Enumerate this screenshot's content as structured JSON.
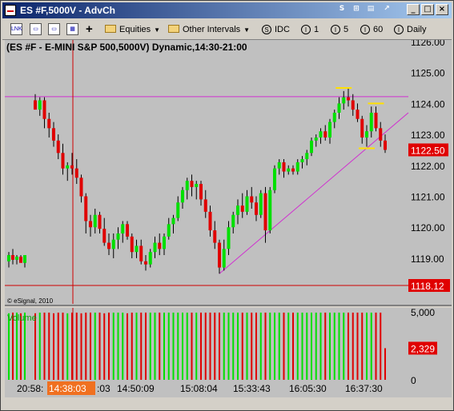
{
  "window": {
    "title": "ES #F,5000V - AdvCh"
  },
  "toolbar": {
    "equities": "Equities",
    "other_intervals": "Other Intervals",
    "idc": "IDC",
    "i1": "1",
    "i5": "5",
    "i60": "60",
    "daily": "Daily"
  },
  "chart_data": {
    "type": "candlestick",
    "title": "(ES #F - E-MINI S&P 500,5000V) Dynamic,14:30-21:00",
    "copyright": "© eSignal, 2010",
    "price_axis": {
      "labels": [
        "1126.00",
        "1125.00",
        "1124.00",
        "1123.00",
        "1122.00",
        "1121.00",
        "1120.00",
        "1119.00"
      ],
      "ylim": [
        1117.5,
        1126.05
      ]
    },
    "last_price": "1122.50",
    "line_price": "1118.12",
    "upper_line_price": 1124.22,
    "volume_label": "Volume",
    "volume_axis": {
      "labels": [
        "5,000",
        "0"
      ],
      "ylim": [
        0,
        5300
      ]
    },
    "last_volume": "2,329",
    "time_labels": [
      "20:58:",
      "14:38:03",
      ":03",
      "14:50:09",
      "15:08:04",
      "15:33:43",
      "16:05:30",
      "16:37:30"
    ],
    "cursor_time": "14:38:03",
    "candles": [
      [
        1118.9,
        1119.2,
        1118.7,
        1119.1
      ],
      [
        1119.1,
        1119.3,
        1118.8,
        1118.95
      ],
      [
        1118.95,
        1119.1,
        1118.8,
        1119.05
      ],
      [
        1119.05,
        1119.1,
        1118.9,
        1118.85
      ],
      [
        1118.85,
        1118.9,
        1118.7,
        1119.1
      ],
      [
        1124.1,
        1124.3,
        1123.9,
        1123.8
      ],
      [
        1123.8,
        1124.2,
        1123.6,
        1124.1
      ],
      [
        1124.1,
        1124.2,
        1123.2,
        1123.5
      ],
      [
        1123.5,
        1123.7,
        1122.9,
        1123.2
      ],
      [
        1123.2,
        1123.4,
        1122.6,
        1122.8
      ],
      [
        1122.8,
        1123.0,
        1122.2,
        1122.4
      ],
      [
        1122.4,
        1122.7,
        1121.7,
        1121.9
      ],
      [
        1121.9,
        1122.1,
        1121.5,
        1122.0
      ],
      [
        1122.0,
        1122.4,
        1121.7,
        1121.9
      ],
      [
        1121.9,
        1122.2,
        1121.4,
        1121.6
      ],
      [
        1121.6,
        1121.7,
        1120.8,
        1121.0
      ],
      [
        1121.0,
        1121.1,
        1119.8,
        1120.2
      ],
      [
        1120.2,
        1120.4,
        1119.7,
        1120.0
      ],
      [
        1120.0,
        1120.6,
        1119.8,
        1120.4
      ],
      [
        1120.4,
        1120.5,
        1119.8,
        1119.95
      ],
      [
        1119.95,
        1120.3,
        1119.4,
        1119.5
      ],
      [
        1119.5,
        1119.8,
        1119.1,
        1119.3
      ],
      [
        1119.3,
        1119.8,
        1119.0,
        1119.6
      ],
      [
        1119.6,
        1120.0,
        1119.3,
        1119.8
      ],
      [
        1119.8,
        1120.2,
        1119.5,
        1120.1
      ],
      [
        1120.1,
        1120.2,
        1119.6,
        1119.7
      ],
      [
        1119.7,
        1119.8,
        1119.0,
        1119.2
      ],
      [
        1119.2,
        1119.6,
        1119.0,
        1119.4
      ],
      [
        1119.4,
        1119.6,
        1118.8,
        1118.9
      ],
      [
        1118.9,
        1119.1,
        1118.6,
        1118.8
      ],
      [
        1118.8,
        1119.3,
        1118.7,
        1119.2
      ],
      [
        1119.2,
        1119.7,
        1119.0,
        1119.5
      ],
      [
        1119.5,
        1119.8,
        1119.1,
        1119.3
      ],
      [
        1119.3,
        1119.8,
        1119.1,
        1119.7
      ],
      [
        1119.7,
        1120.3,
        1119.6,
        1120.1
      ],
      [
        1120.1,
        1120.4,
        1119.8,
        1120.3
      ],
      [
        1120.3,
        1121.0,
        1120.2,
        1120.8
      ],
      [
        1120.8,
        1121.3,
        1120.6,
        1121.2
      ],
      [
        1121.2,
        1121.6,
        1120.9,
        1121.5
      ],
      [
        1121.5,
        1121.7,
        1121.0,
        1121.3
      ],
      [
        1121.3,
        1121.5,
        1120.9,
        1121.4
      ],
      [
        1121.4,
        1121.5,
        1120.7,
        1120.9
      ],
      [
        1120.9,
        1121.2,
        1120.3,
        1120.5
      ],
      [
        1120.5,
        1120.7,
        1119.7,
        1119.9
      ],
      [
        1119.9,
        1120.2,
        1119.3,
        1119.5
      ],
      [
        1119.5,
        1119.6,
        1118.5,
        1118.7
      ],
      [
        1118.7,
        1119.6,
        1118.6,
        1119.3
      ],
      [
        1119.3,
        1120.2,
        1119.1,
        1120.0
      ],
      [
        1120.0,
        1120.5,
        1119.8,
        1120.4
      ],
      [
        1120.4,
        1120.9,
        1120.1,
        1120.7
      ],
      [
        1120.7,
        1121.1,
        1120.3,
        1120.5
      ],
      [
        1120.5,
        1121.2,
        1120.4,
        1121.0
      ],
      [
        1121.0,
        1121.3,
        1120.6,
        1120.8
      ],
      [
        1120.8,
        1121.0,
        1120.2,
        1120.4
      ],
      [
        1120.4,
        1121.2,
        1120.3,
        1121.1
      ],
      [
        1121.1,
        1121.3,
        1119.5,
        1119.9
      ],
      [
        1119.9,
        1121.3,
        1119.8,
        1121.2
      ],
      [
        1121.2,
        1122.0,
        1121.1,
        1121.9
      ],
      [
        1121.9,
        1122.2,
        1121.7,
        1122.1
      ],
      [
        1122.1,
        1122.2,
        1121.6,
        1121.8
      ],
      [
        1121.8,
        1122.0,
        1121.7,
        1121.9
      ],
      [
        1121.9,
        1122.0,
        1121.7,
        1121.8
      ],
      [
        1121.8,
        1122.2,
        1121.7,
        1122.1
      ],
      [
        1122.1,
        1122.3,
        1121.9,
        1122.2
      ],
      [
        1122.2,
        1122.5,
        1122.0,
        1122.4
      ],
      [
        1122.4,
        1122.9,
        1122.3,
        1122.8
      ],
      [
        1122.8,
        1123.0,
        1122.6,
        1122.9
      ],
      [
        1122.9,
        1123.2,
        1122.7,
        1123.1
      ],
      [
        1123.1,
        1123.3,
        1122.8,
        1122.9
      ],
      [
        1122.9,
        1123.5,
        1122.7,
        1123.4
      ],
      [
        1123.4,
        1123.8,
        1123.2,
        1123.7
      ],
      [
        1123.7,
        1124.2,
        1123.5,
        1124.0
      ],
      [
        1124.0,
        1124.4,
        1123.8,
        1124.2
      ],
      [
        1124.2,
        1124.5,
        1123.9,
        1124.1
      ],
      [
        1124.1,
        1124.3,
        1123.6,
        1123.8
      ],
      [
        1123.8,
        1124.0,
        1123.4,
        1123.5
      ],
      [
        1123.5,
        1123.6,
        1122.7,
        1122.9
      ],
      [
        1122.9,
        1123.3,
        1122.6,
        1123.1
      ],
      [
        1123.1,
        1123.9,
        1122.9,
        1123.7
      ],
      [
        1123.7,
        1123.9,
        1123.1,
        1123.2
      ],
      [
        1123.2,
        1123.4,
        1122.6,
        1122.8
      ],
      [
        1122.8,
        1123.0,
        1122.4,
        1122.5
      ]
    ],
    "volumes": [
      4900,
      4950,
      4950,
      4900,
      4950,
      4900,
      4950,
      4950,
      4950,
      4900,
      4950,
      4950,
      4900,
      4950,
      4950,
      4900,
      4950,
      4950,
      4950,
      4950,
      4900,
      4950,
      4950,
      4950,
      4950,
      4900,
      4950,
      4950,
      4950,
      4950,
      4950,
      4950,
      4950,
      4950,
      4950,
      4950,
      4950,
      4950,
      4950,
      4950,
      4950,
      4950,
      4950,
      4950,
      4950,
      4950,
      4950,
      4950,
      4950,
      4950,
      4950,
      4950,
      4950,
      4950,
      4950,
      4950,
      4950,
      4950,
      4950,
      4950,
      4950,
      4950,
      4950,
      4950,
      4950,
      4950,
      4950,
      4950,
      4950,
      4950,
      4950,
      4950,
      4950,
      4950,
      4950,
      4950,
      4950,
      4950,
      4950,
      4950,
      4950,
      2329
    ]
  }
}
